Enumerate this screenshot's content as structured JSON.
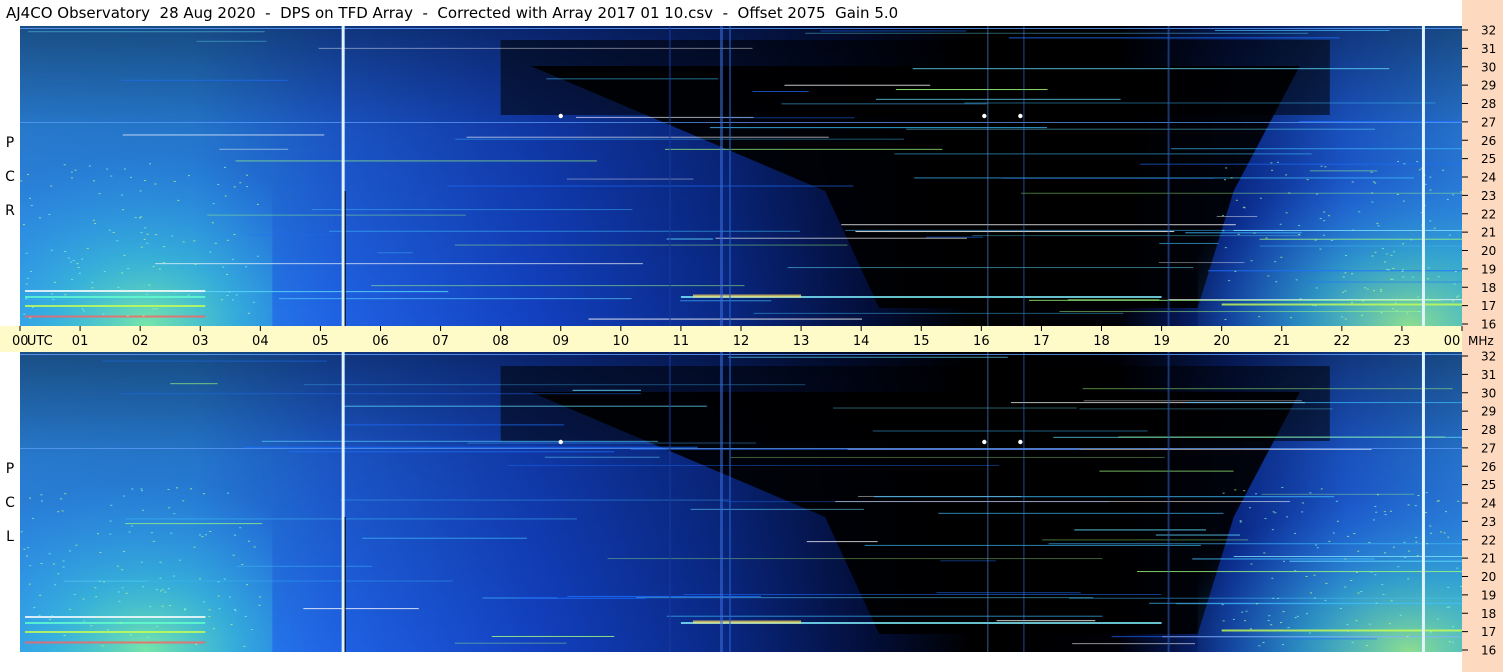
{
  "title": "AJ4CO Observatory  28 Aug 2020  -  DPS on TFD Array  -  Corrected with Array 2017 01 10.csv  -  Offset 2075  Gain 5.0",
  "chart_data": [
    {
      "type": "heatmap",
      "panel": "RCP",
      "panel_label": "R C P",
      "x_axis": {
        "label": "UTC",
        "ticks": [
          "00",
          "01",
          "02",
          "03",
          "04",
          "05",
          "06",
          "07",
          "08",
          "09",
          "10",
          "11",
          "12",
          "13",
          "14",
          "15",
          "16",
          "17",
          "18",
          "19",
          "20",
          "21",
          "22",
          "23",
          "00"
        ],
        "range": [
          0,
          24
        ]
      },
      "y_axis": {
        "label": "MHz",
        "ticks": [
          "16",
          "17",
          "18",
          "19",
          "20",
          "21",
          "22",
          "23",
          "24",
          "25",
          "26",
          "27",
          "28",
          "29",
          "30",
          "31",
          "32"
        ],
        "range": [
          16,
          32
        ]
      },
      "colormap": [
        "#000000",
        "#0a1a8c",
        "#1e50e6",
        "#28a0f0",
        "#40e0c8",
        "#c8ff50",
        "#ff4040"
      ],
      "grid": false
    },
    {
      "type": "heatmap",
      "panel": "LCP",
      "panel_label": "L C P",
      "x_axis": {
        "label": "UTC",
        "ticks": [
          "00",
          "01",
          "02",
          "03",
          "04",
          "05",
          "06",
          "07",
          "08",
          "09",
          "10",
          "11",
          "12",
          "13",
          "14",
          "15",
          "16",
          "17",
          "18",
          "19",
          "20",
          "21",
          "22",
          "23",
          "00"
        ],
        "range": [
          0,
          24
        ]
      },
      "y_axis": {
        "label": "MHz",
        "ticks": [
          "16",
          "17",
          "18",
          "19",
          "20",
          "21",
          "22",
          "23",
          "24",
          "25",
          "26",
          "27",
          "28",
          "29",
          "30",
          "31",
          "32"
        ],
        "range": [
          16,
          32
        ]
      },
      "colormap": [
        "#000000",
        "#0a1a8c",
        "#1e50e6",
        "#28a0f0",
        "#40e0c8",
        "#c8ff50",
        "#ff4040"
      ],
      "grid": false
    }
  ],
  "time_axis": {
    "ticks": [
      "00",
      "01",
      "02",
      "03",
      "04",
      "05",
      "06",
      "07",
      "08",
      "09",
      "10",
      "11",
      "12",
      "13",
      "14",
      "15",
      "16",
      "17",
      "18",
      "19",
      "20",
      "21",
      "22",
      "23",
      "00"
    ],
    "utc_label": "UTC",
    "mhz_label": "MHz"
  },
  "freq_axis": {
    "ticks": [
      "16",
      "17",
      "18",
      "19",
      "20",
      "21",
      "22",
      "23",
      "24",
      "25",
      "26",
      "27",
      "28",
      "29",
      "30",
      "31",
      "32"
    ]
  }
}
